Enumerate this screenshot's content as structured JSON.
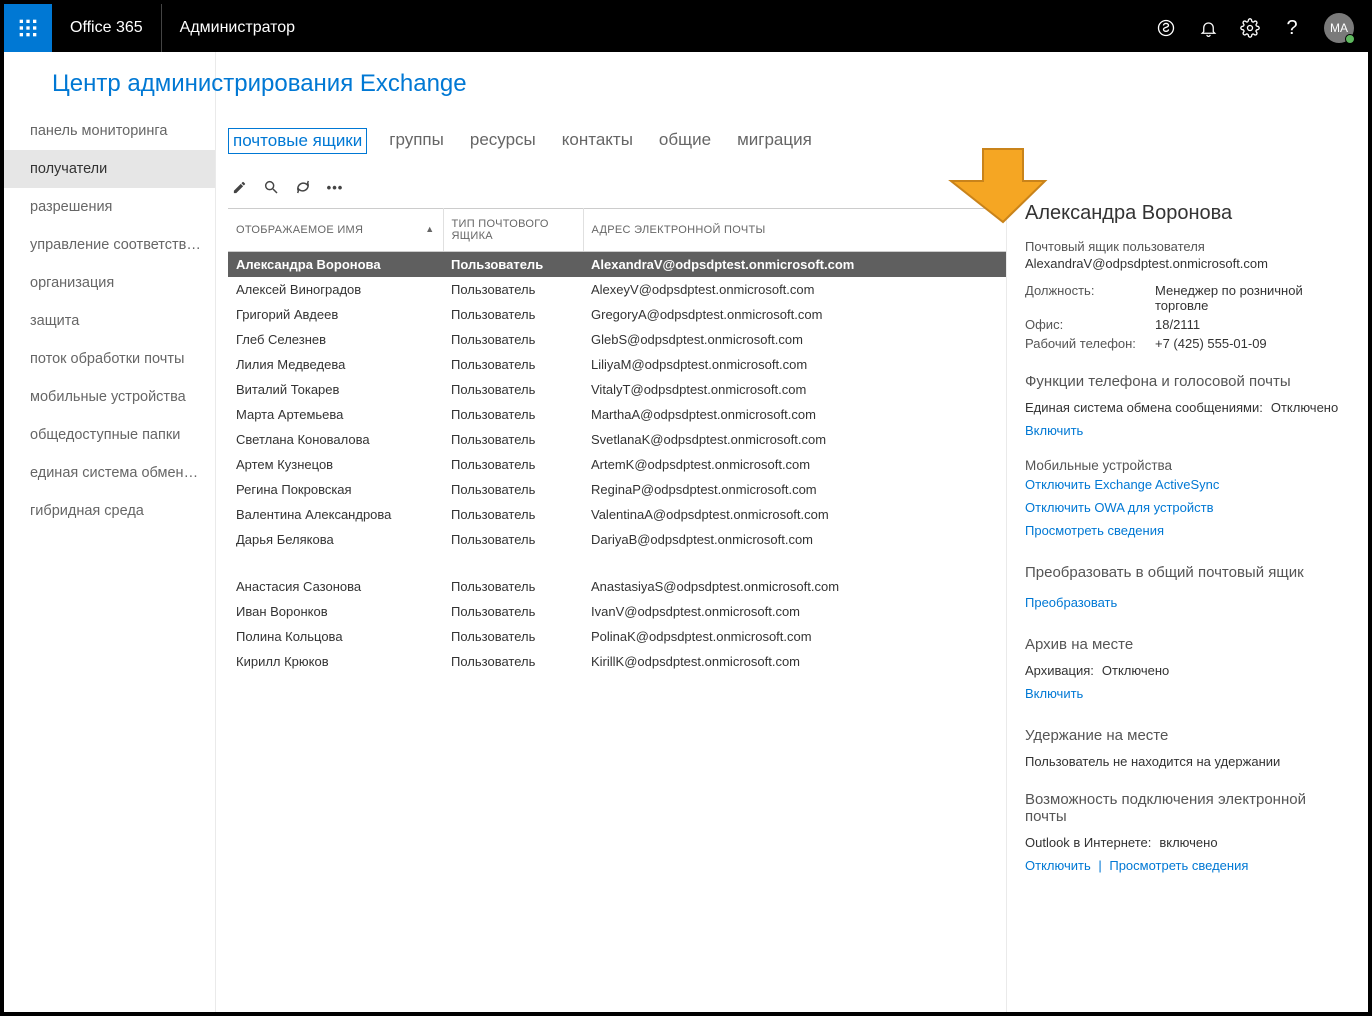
{
  "topbar": {
    "brand": "Office 365",
    "role": "Администратор",
    "avatar_initials": "MA"
  },
  "page_title": "Центр администрирования Exchange",
  "nav": [
    "панель мониторинга",
    "получатели",
    "разрешения",
    "управление соответстви...",
    "организация",
    "защита",
    "поток обработки почты",
    "мобильные устройства",
    "общедоступные папки",
    "единая система обмена...",
    "гибридная среда"
  ],
  "nav_active_index": 1,
  "tabs": [
    "почтовые ящики",
    "группы",
    "ресурсы",
    "контакты",
    "общие",
    "миграция"
  ],
  "tab_active_index": 0,
  "table": {
    "columns": [
      "ОТОБРАЖАЕМОЕ ИМЯ",
      "ТИП ПОЧТОВОГО ЯЩИКА",
      "АДРЕС ЭЛЕКТРОННОЙ ПОЧТЫ"
    ],
    "col_widths": [
      "215px",
      "140px",
      "auto"
    ],
    "rows": [
      {
        "name": "Александра Воронова",
        "type": "Пользователь",
        "email": "AlexandraV@odpsdptest.onmicrosoft.com",
        "selected": true
      },
      {
        "name": "Алексей Виноградов",
        "type": "Пользователь",
        "email": "AlexeyV@odpsdptest.onmicrosoft.com"
      },
      {
        "name": "Григорий Авдеев",
        "type": "Пользователь",
        "email": "GregoryA@odpsdptest.onmicrosoft.com"
      },
      {
        "name": "Глеб Селезнев",
        "type": "Пользователь",
        "email": "GlebS@odpsdptest.onmicrosoft.com"
      },
      {
        "name": "Лилия Медведева",
        "type": "Пользователь",
        "email": "LiliyaM@odpsdptest.onmicrosoft.com"
      },
      {
        "name": "Виталий Токарев",
        "type": "Пользователь",
        "email": "VitalyT@odpsdptest.onmicrosoft.com"
      },
      {
        "name": "Марта Артемьева",
        "type": "Пользователь",
        "email": "MarthaA@odpsdptest.onmicrosoft.com"
      },
      {
        "name": "Светлана Коновалова",
        "type": "Пользователь",
        "email": "SvetlanaK@odpsdptest.onmicrosoft.com"
      },
      {
        "name": "Артем Кузнецов",
        "type": "Пользователь",
        "email": "ArtemK@odpsdptest.onmicrosoft.com"
      },
      {
        "name": "Регина Покровская",
        "type": "Пользователь",
        "email": "ReginaP@odpsdptest.onmicrosoft.com"
      },
      {
        "name": "Валентина Александрова",
        "type": "Пользователь",
        "email": "ValentinaA@odpsdptest.onmicrosoft.com"
      },
      {
        "name": "Дарья Белякова",
        "type": "Пользователь",
        "email": "DariyaB@odpsdptest.onmicrosoft.com"
      },
      {
        "empty": true
      },
      {
        "name": "Анастасия Сазонова",
        "type": "Пользователь",
        "email": "AnastasiyaS@odpsdptest.onmicrosoft.com"
      },
      {
        "name": "Иван Воронков",
        "type": "Пользователь",
        "email": "IvanV@odpsdptest.onmicrosoft.com"
      },
      {
        "name": "Полина Кольцова",
        "type": "Пользователь",
        "email": "PolinaK@odpsdptest.onmicrosoft.com"
      },
      {
        "name": "Кирилл Крюков",
        "type": "Пользователь",
        "email": "KirillK@odpsdptest.onmicrosoft.com"
      }
    ]
  },
  "details": {
    "title": "Александра Воронова",
    "subtitle": "Почтовый ящик пользователя",
    "email": "AlexandraV@odpsdptest.onmicrosoft.com",
    "fields": {
      "position_label": "Должность:",
      "position_value": "Менеджер по розничной торговле",
      "office_label": "Офис:",
      "office_value": "18/2111",
      "workphone_label": "Рабочий телефон:",
      "workphone_value": "+7 (425) 555-01-09"
    },
    "phone_section": "Функции телефона и голосовой почты",
    "um_label": "Единая система обмена сообщениями:",
    "um_value": "Отключено",
    "enable_link": "Включить",
    "mobile_h": "Мобильные устройства",
    "link_disable_eas": "Отключить Exchange ActiveSync",
    "link_disable_owa": "Отключить OWA для устройств",
    "link_view_details": "Просмотреть сведения",
    "convert_section": "Преобразовать в общий почтовый ящик",
    "convert_link": "Преобразовать",
    "archive_section": "Архив на месте",
    "archive_label": "Архивация:",
    "archive_value": "Отключено",
    "archive_enable": "Включить",
    "hold_section": "Удержание на месте",
    "hold_text": "Пользователь не находится на удержании",
    "connect_section": "Возможность подключения электронной почты",
    "owa_label": "Outlook в Интернете:",
    "owa_value": "включено",
    "owa_disable": "Отключить",
    "owa_view": "Просмотреть сведения"
  }
}
